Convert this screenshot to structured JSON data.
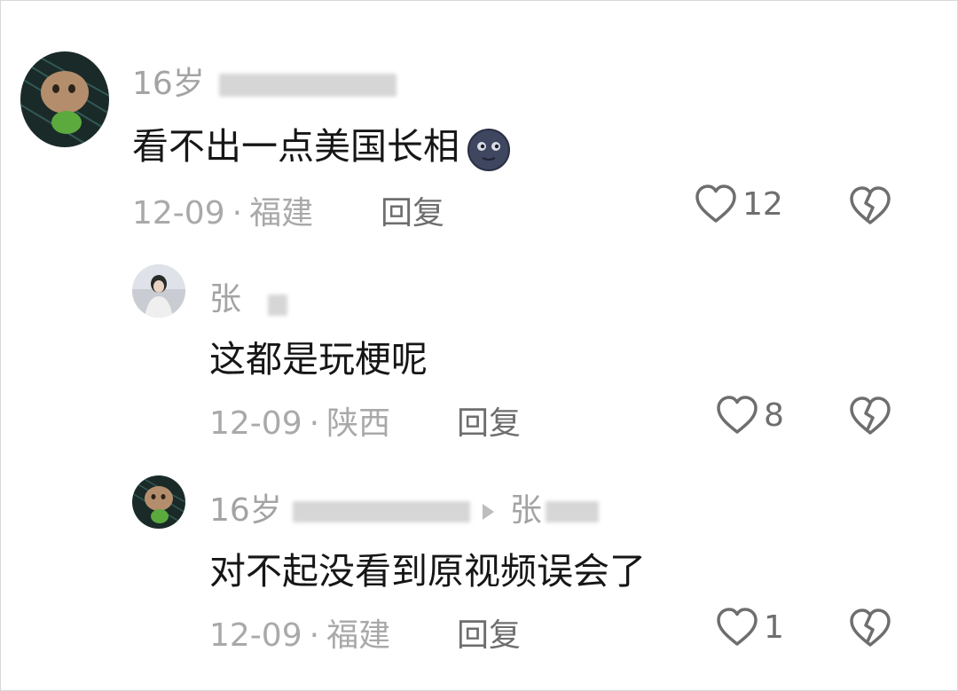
{
  "comments": [
    {
      "username": "16岁",
      "text": "看不出一点美国长相",
      "emoji": "new-moon-face-icon",
      "date": "12-09",
      "location": "福建",
      "reply_label": "回复",
      "likes": "12"
    },
    {
      "username": "张",
      "text": "这都是玩梗呢",
      "date": "12-09",
      "location": "陕西",
      "reply_label": "回复",
      "likes": "8"
    },
    {
      "username": "16岁",
      "reply_to": "张",
      "text": "对不起没看到原视频误会了",
      "date": "12-09",
      "location": "福建",
      "reply_label": "回复",
      "likes": "1"
    }
  ],
  "separator": "·",
  "colors": {
    "text": "#161616",
    "meta": "#a9a9a9",
    "action": "#6e6e6e"
  }
}
